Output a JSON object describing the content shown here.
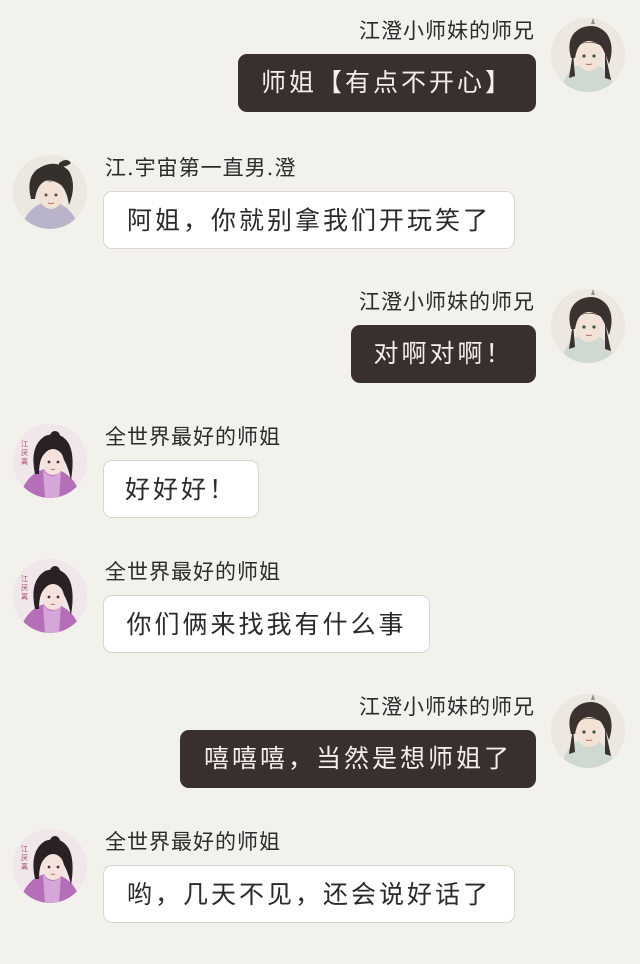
{
  "messages": [
    {
      "side": "right",
      "avatar": "senior-brother-avatar",
      "name": "江澄小师妹的师兄",
      "text": "师姐【有点不开心】",
      "style": "dark"
    },
    {
      "side": "left",
      "avatar": "jiang-cheng-avatar",
      "name": "江.宇宙第一直男.澄",
      "text": "阿姐，你就别拿我们开玩笑了",
      "style": "light"
    },
    {
      "side": "right",
      "avatar": "senior-brother-avatar",
      "name": "江澄小师妹的师兄",
      "text": "对啊对啊！",
      "style": "dark"
    },
    {
      "side": "left",
      "avatar": "senior-sister-avatar",
      "name": "全世界最好的师姐",
      "text": "好好好！",
      "style": "light"
    },
    {
      "side": "left",
      "avatar": "senior-sister-avatar",
      "name": "全世界最好的师姐",
      "text": "你们俩来找我有什么事",
      "style": "light"
    },
    {
      "side": "right",
      "avatar": "senior-brother-avatar",
      "name": "江澄小师妹的师兄",
      "text": "嘻嘻嘻，当然是想师姐了",
      "style": "dark"
    },
    {
      "side": "left",
      "avatar": "senior-sister-avatar",
      "name": "全世界最好的师姐",
      "text": "哟，几天不见，还会说好话了",
      "style": "light"
    }
  ],
  "colors": {
    "background": "#f2f1ec",
    "dark_bubble": "#3a2f2f",
    "light_bubble": "#ffffff"
  }
}
